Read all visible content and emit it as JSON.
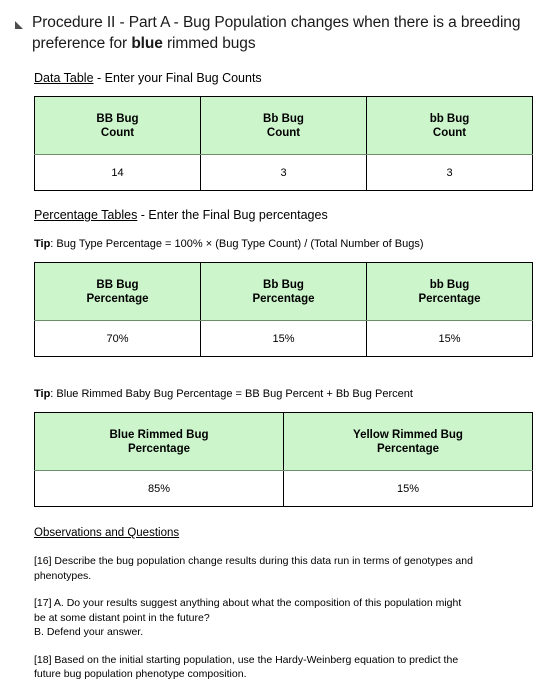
{
  "header": {
    "collapse_icon": "collapse-triangle-icon",
    "title_prefix": "Procedure II - Part A - Bug Population changes when there is a breeding preference for ",
    "title_emphasis": "blue",
    "title_suffix": " rimmed bugs"
  },
  "sections": {
    "data_table": {
      "heading_underlined": "Data Table",
      "heading_rest": " - Enter your Final Bug Counts"
    },
    "percentage_tables": {
      "heading_underlined": "Percentage Tables",
      "heading_rest": " - Enter the Final Bug percentages"
    },
    "observations": {
      "heading": "Observations and Questions"
    }
  },
  "tips": {
    "tip_label": "Tip",
    "tip_percentage": ": Bug Type Percentage = 100% × (Bug Type Count) / (Total Number of Bugs)",
    "tip_blue_rimmed": ": Blue Rimmed Baby Bug Percentage = BB Bug Percent + Bb Bug Percent"
  },
  "tables": {
    "counts": {
      "headers": [
        "BB Bug\nCount",
        "Bb Bug\nCount",
        "bb Bug\nCount"
      ],
      "header_lines": [
        [
          "BB Bug",
          "Count"
        ],
        [
          "Bb Bug",
          "Count"
        ],
        [
          "bb Bug",
          "Count"
        ]
      ],
      "values": [
        "14",
        "3",
        "3"
      ]
    },
    "genotype_percentages": {
      "header_lines": [
        [
          "BB Bug",
          "Percentage"
        ],
        [
          "Bb Bug",
          "Percentage"
        ],
        [
          "bb Bug",
          "Percentage"
        ]
      ],
      "values": [
        "70%",
        "15%",
        "15%"
      ]
    },
    "phenotype_percentages": {
      "header_lines": [
        [
          "Blue Rimmed Bug",
          "Percentage"
        ],
        [
          "Yellow Rimmed Bug",
          "Percentage"
        ]
      ],
      "values": [
        "85%",
        "15%"
      ]
    }
  },
  "questions": [
    {
      "lines": [
        "[16] Describe the bug population change results during this data run in terms of genotypes and",
        "phenotypes."
      ]
    },
    {
      "lines": [
        "[17] A. Do your results suggest anything about what the composition of this population might",
        "be at some distant point in the future?",
        "B. Defend your answer."
      ]
    },
    {
      "lines": [
        "[18] Based on the initial starting population, use the Hardy-Weinberg equation to predict the",
        "future bug population phenotype composition."
      ]
    }
  ],
  "colors": {
    "header_green": "#ccf5cc",
    "border_black": "#000000",
    "header_rule_gray": "#6b8f6b",
    "text_black": "#000000"
  }
}
